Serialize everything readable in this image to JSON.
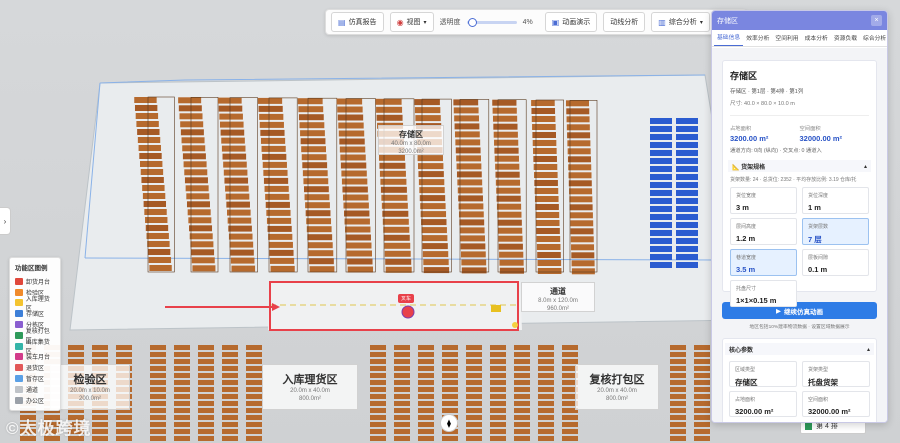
{
  "toolbar": {
    "report_label": "仿真报告",
    "view_label": "视图",
    "opacity_label": "透明度",
    "opacity_value": "4%",
    "opacity_fraction": 0.04,
    "animation_label": "动画演示",
    "flow_label": "动线分析",
    "analysis_label": "综合分析",
    "extra_label": "导"
  },
  "scene": {
    "storage_label": "存储区",
    "storage_sub1": "40.0m x 80.0m",
    "storage_sub2": "3200.0m²",
    "aisle_label": "通道",
    "aisle_sub1": "8.0m x 120.0m",
    "aisle_sub2": "960.0m²",
    "inspect_label": "检验区",
    "inspect_sub1": "20.0m x 10.0m",
    "inspect_sub2": "200.0m²",
    "inbound_label": "入库理货区",
    "inbound_sub1": "20.0m x 40.0m",
    "inbound_sub2": "800.0m²",
    "pack_label": "复核打包区",
    "pack_sub1": "20.0m x 40.0m",
    "pack_sub2": "800.0m²",
    "forklift_tag": "叉车"
  },
  "legend": {
    "title": "功能区图例",
    "items": [
      {
        "label": "卸货月台",
        "color": "#e0483c"
      },
      {
        "label": "检验区",
        "color": "#f08a2b"
      },
      {
        "label": "入库理货区",
        "color": "#f4c430"
      },
      {
        "label": "存储区",
        "color": "#3d7fd8"
      },
      {
        "label": "分拣区",
        "color": "#8a5fd0"
      },
      {
        "label": "复核打包区",
        "color": "#2e9a5a"
      },
      {
        "label": "出库集货区",
        "color": "#34b4a8"
      },
      {
        "label": "装车月台",
        "color": "#d23b8a"
      },
      {
        "label": "退货区",
        "color": "#e25858"
      },
      {
        "label": "暂存区",
        "color": "#5aa0e6"
      },
      {
        "label": "通道",
        "color": "#bfc3c8"
      },
      {
        "label": "办公区",
        "color": "#9aa0a8"
      }
    ]
  },
  "watermark": "©太极跨境",
  "floor": {
    "label": "第 4 排"
  },
  "panel": {
    "title": "存储区",
    "tabs": [
      "基础信息",
      "效率分析",
      "空间利用",
      "成本分析",
      "资源负载",
      "综合分析"
    ],
    "active_tab": 0,
    "zone_title": "存储区",
    "zone_path": "存储区 · 第1层 · 第4排 · 第1列",
    "zone_size": "尺寸: 40.0 × 80.0 × 10.0 m",
    "area_label": "占地面积",
    "area_value": "3200.00 m²",
    "space_label": "空间面积",
    "space_value": "32000.00 m²",
    "access_note": "通道方向: 0向 (纵向) · 交叉点: 0 通道入",
    "shelf_section": "货架规格",
    "shelf_caption": "货架数量: 24 · 总货位: 2352 · 平均存放比例: 3.19 仓库/托",
    "cells": [
      {
        "k": "货位宽度",
        "v": "3 m",
        "hl": false
      },
      {
        "k": "货位深度",
        "v": "1 m",
        "hl": false
      },
      {
        "k": "层间高度",
        "v": "1.2 m",
        "hl": false
      },
      {
        "k": "货架层数",
        "v": "7 层",
        "hl": true
      },
      {
        "k": "巷道宽度",
        "v": "3.5 m",
        "hl": true
      },
      {
        "k": "层板间隙",
        "v": "0.1 m",
        "hl": false
      },
      {
        "k": "托盘尺寸",
        "v": "1×1×0.15 m",
        "hl": false
      }
    ],
    "sim_button": "继续仿真动画",
    "sim_hint": "地区包括10%建率物流数据 · 设置区域数据展示",
    "core_section": "核心参数",
    "core_cells": [
      {
        "k": "区域类型",
        "v": "存储区"
      },
      {
        "k": "货架类型",
        "v": "托盘货架"
      },
      {
        "k": "占地面积",
        "v": "3200.00 m²"
      },
      {
        "k": "空间面积",
        "v": "32000.00 m²"
      }
    ]
  },
  "colors": {
    "accent": "#4a6cd4",
    "panel_header": "#7a86e0",
    "rack_brown": "#b66a2e",
    "rack_blue": "#2b5cd0",
    "highlight_red": "#e8414a"
  }
}
